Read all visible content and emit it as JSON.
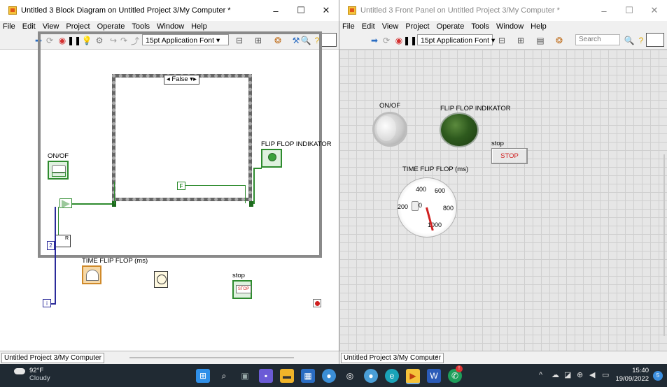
{
  "block_diagram": {
    "title": "Untitled 3 Block Diagram on Untitled Project 3/My Computer *",
    "window_controls": [
      "–",
      "☐",
      "✕"
    ],
    "menu": [
      "File",
      "Edit",
      "View",
      "Project",
      "Operate",
      "Tools",
      "Window",
      "Help"
    ],
    "font_selector": "15pt Application Font",
    "status_project": "Untitled Project 3/My Computer",
    "case_selector": "False",
    "labels": {
      "onof": "ON/OF",
      "flipflop_indikator": "FLIP FLOP INDIKATOR",
      "time_flipflop": "TIME FLIP FLOP (ms)",
      "stop": "stop",
      "stop_terminal_text": "STOP",
      "numeric_const": "2",
      "false_const": "F",
      "iteration": "i",
      "r_label": "R"
    }
  },
  "front_panel": {
    "title": "Untitled 3 Front Panel on Untitled Project 3/My Computer *",
    "window_controls": [
      "–",
      "☐",
      "✕"
    ],
    "menu": [
      "File",
      "Edit",
      "View",
      "Project",
      "Operate",
      "Tools",
      "Window",
      "Help"
    ],
    "font_selector": "15pt Application Font",
    "search_placeholder": "Search",
    "status_project": "Untitled Project 3/My Computer",
    "labels": {
      "onof": "ON/OF",
      "flipflop_indikator": "FLIP FLOP INDIKATOR",
      "stop": "stop",
      "stop_button": "STOP",
      "time_flipflop": "TIME FLIP FLOP (ms)"
    },
    "gauge_ticks": [
      "400",
      "600",
      "200",
      "0",
      "800",
      "1000"
    ],
    "gauge_value": 1000
  },
  "taskbar": {
    "weather_temp": "92°F",
    "weather_desc": "Cloudy",
    "time": "15:40",
    "date": "19/09/2022",
    "notification_count": "5"
  }
}
